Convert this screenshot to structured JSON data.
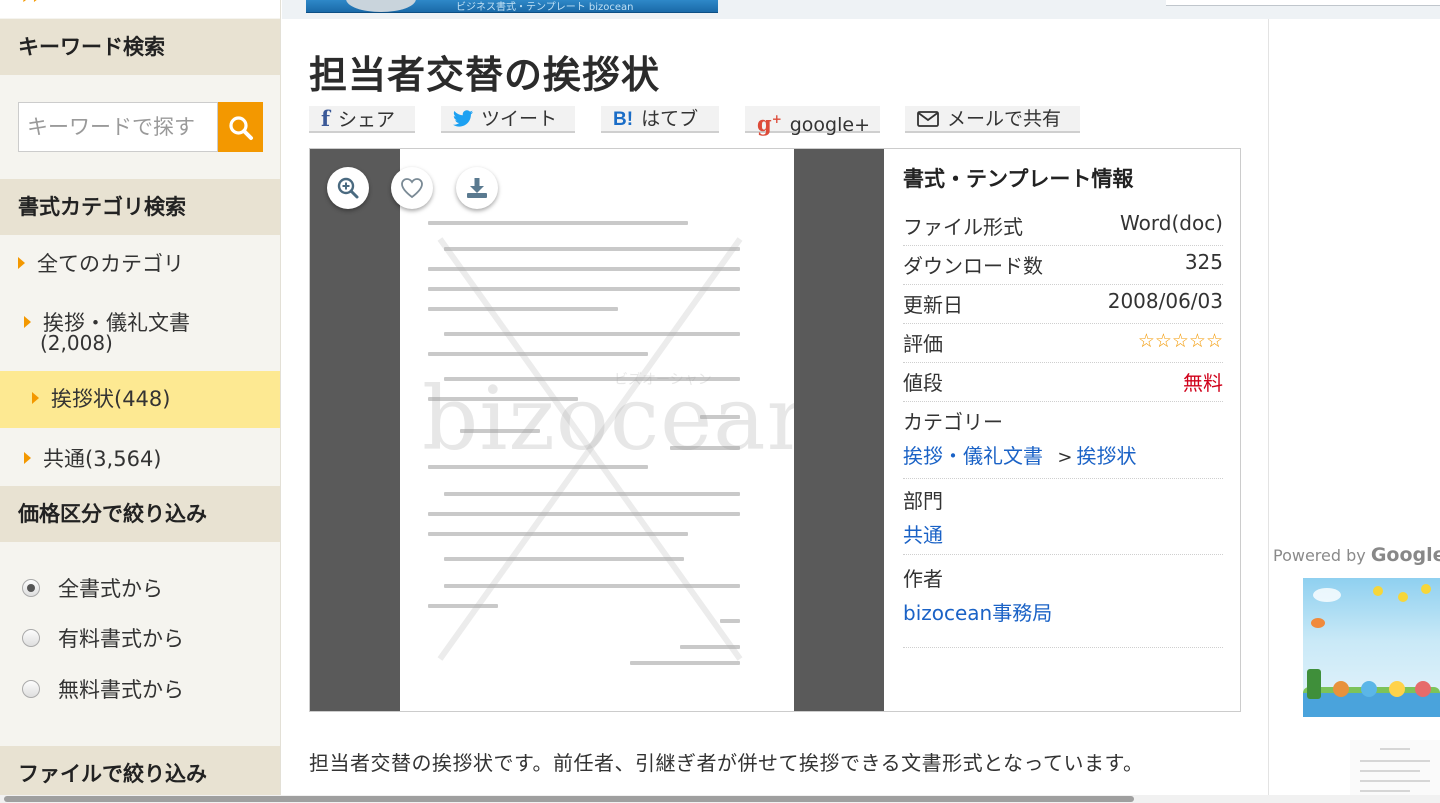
{
  "banner": {
    "text": "ビジネス書式・テンプレート bizocean"
  },
  "sidebar": {
    "keyword_heading": "キーワード検索",
    "search": {
      "placeholder": "キーワードで探す"
    },
    "category_heading": "書式カテゴリ検索",
    "categories": [
      {
        "label": "全てのカテゴリ"
      },
      {
        "label": "挨拶・儀礼文書",
        "count": "(2,008)"
      },
      {
        "label": "挨拶状(448)"
      },
      {
        "label": "共通(3,564)"
      }
    ],
    "price_heading": "価格区分で絞り込み",
    "price_options": [
      {
        "label": "全書式から",
        "selected": true
      },
      {
        "label": "有料書式から",
        "selected": false
      },
      {
        "label": "無料書式から",
        "selected": false
      }
    ],
    "file_heading": "ファイルで絞り込み"
  },
  "main": {
    "title": "担当者交替の挨拶状",
    "share": {
      "facebook": "シェア",
      "twitter": "ツイート",
      "hatena": "はてブ",
      "google": "google+",
      "mail": "メールで共有"
    },
    "icons": {
      "zoom": "zoom-icon",
      "favorite": "heart-icon",
      "download": "download-icon",
      "facebook": "facebook-icon",
      "twitter": "twitter-icon",
      "hatena": "hatena-icon",
      "google": "google-plus-icon",
      "mail": "mail-icon",
      "search": "search-icon"
    },
    "watermark": {
      "text": "bizocean",
      "kana": "ビズオーシャン"
    },
    "info": {
      "title": "書式・テンプレート情報",
      "file_format_label": "ファイル形式",
      "file_format": "Word(doc)",
      "downloads_label": "ダウンロード数",
      "downloads": "325",
      "updated_label": "更新日",
      "updated": "2008/06/03",
      "rating_label": "評価",
      "rating_stars": "☆☆☆☆☆",
      "rating_value": 0,
      "price_label": "値段",
      "price": "無料",
      "category_label": "カテゴリー",
      "category_parent": "挨拶・儀礼文書",
      "category_sep": ">",
      "category_child": "挨拶状",
      "department_label": "部門",
      "department": "共通",
      "author_label": "作者",
      "author": "bizocean事務局"
    },
    "description": "担当者交替の挨拶状です。前任者、引継ぎ者が併せて挨拶できる文書形式となっています。"
  },
  "right": {
    "powered_prefix": "Powered by",
    "powered_brand": "Google"
  },
  "colors": {
    "accent": "#f39800",
    "highlight": "#fde992",
    "link": "#1a62c6",
    "price_free": "#d0021b",
    "sidebar_heading_bg": "#e8e2d2"
  }
}
